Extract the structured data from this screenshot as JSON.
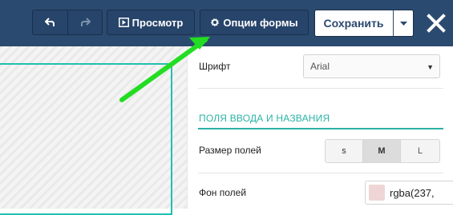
{
  "toolbar": {
    "undo_icon": "undo-icon",
    "redo_icon": "redo-icon",
    "preview_label": "Просмотр",
    "preview_icon": "play-box-icon",
    "options_label": "Опции формы",
    "options_icon": "gear-icon",
    "save_label": "Сохранить",
    "save_dropdown_icon": "caret-down-icon",
    "close_icon": "close-icon",
    "bg_color": "#2b4a6f"
  },
  "settings": {
    "font_label": "Шрифт",
    "font_value": "Arial",
    "section_title": "ПОЛЯ ВВОДА И НАЗВАНИЯ",
    "field_size_label": "Размер полей",
    "size_options": [
      "s",
      "M",
      "L"
    ],
    "size_selected": "M",
    "field_bg_label": "Фон полей",
    "field_bg_value": "rgba(237,",
    "field_bg_swatch": "#efd5d5",
    "accent_color": "#2ab3a5"
  },
  "annotation": {
    "arrow_color": "#22dd22"
  }
}
